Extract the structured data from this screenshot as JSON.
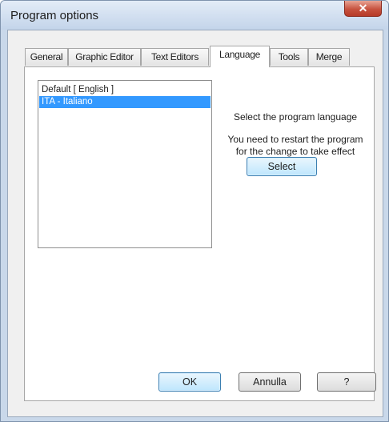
{
  "window": {
    "title": "Program options",
    "close_glyph": "✕"
  },
  "tabs": [
    {
      "label": "General",
      "active": false
    },
    {
      "label": "Graphic Editor",
      "active": false
    },
    {
      "label": "Text Editors",
      "active": false
    },
    {
      "label": "Language",
      "active": true
    },
    {
      "label": "Tools",
      "active": false
    },
    {
      "label": "Merge",
      "active": false
    }
  ],
  "language_panel": {
    "languages": [
      {
        "label": "Default [ English ]",
        "selected": false
      },
      {
        "label": "ITA - Italiano",
        "selected": true
      }
    ],
    "prompt": "Select the program language",
    "restart_note_line1": "You need to restart the program",
    "restart_note_line2": "for the change to take effect",
    "select_button": "Select"
  },
  "buttons": {
    "ok": "OK",
    "cancel": "Annulla",
    "help": "?"
  },
  "colors": {
    "selection": "#3399ff",
    "close_button": "#c7523f",
    "window_frame": "#c9d8ea"
  }
}
